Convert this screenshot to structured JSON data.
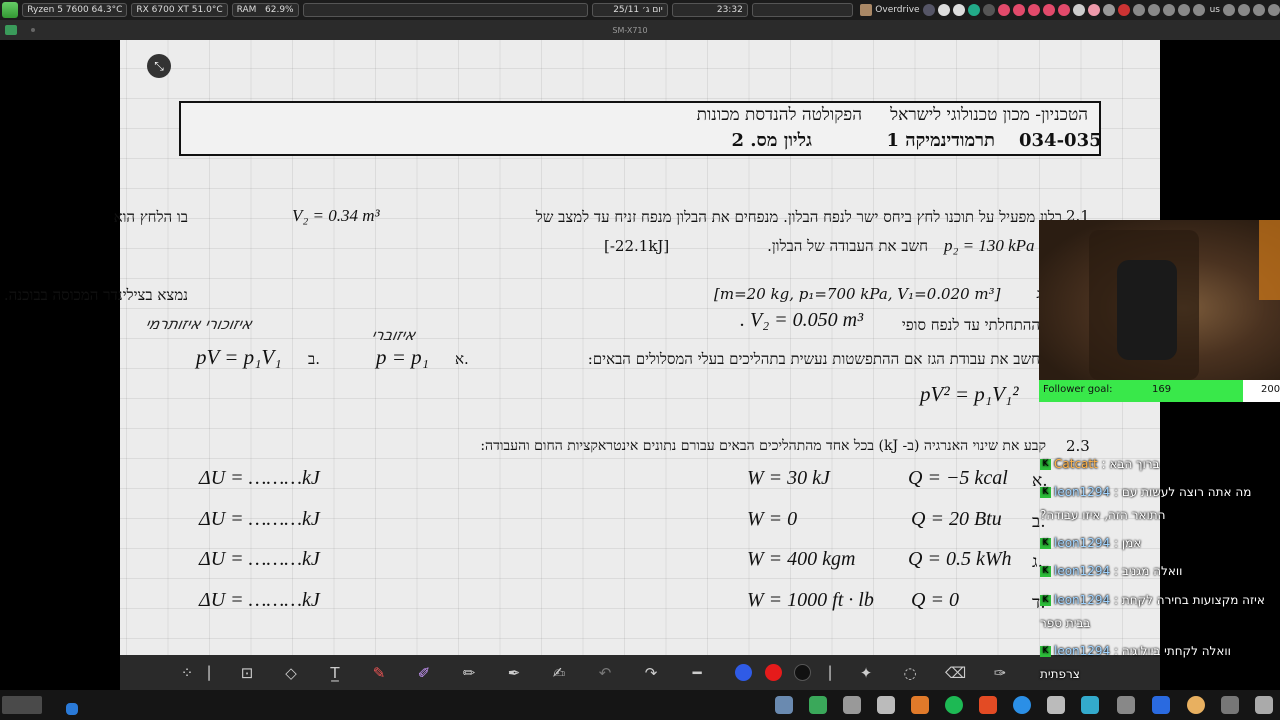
{
  "topbar": {
    "cpu": "Ryzen 5 7600  64.3°C",
    "gpu": "RX 6700 XT 51.0°C",
    "ram_label": "RAM",
    "ram_value": "62.9%",
    "date": "25/11 יום ג׳",
    "time": "23:32",
    "overdrive": "Overdrive",
    "lang": "us"
  },
  "window": {
    "title": "SM-X710"
  },
  "document": {
    "header": {
      "institute": "הטכניון- מכון טכנולוגי לישראל",
      "faculty": "הפקולטה להנדסת מכונות",
      "course_code": "034-035",
      "course_name": "תרמודינמיקה 1",
      "sheet": "גליון מס. 2"
    },
    "q21": {
      "num": "2.1",
      "line1": "בלון מפעיל על תוכנו לחץ ביחס ישר לנפח הבלון. מנפחים את הבלון מנפח זניח עד למצב של",
      "v2": "V₂ = 0.34 m³",
      "line1_end": "בו הלחץ הוא",
      "p2": "p₂ = 130 kPa",
      "line2": "חשב את העבודה של הבלון.",
      "answer": "[-22.1kJ]"
    },
    "q22": {
      "given": "[m=20 kg, p₁=700 kPa, V₁=0.020 m³]",
      "line1": "נמצא בצילינדר המכוסה בבוכנה. הגז מתפשט, בתהליך קוואזיסטטי  מהמצב",
      "prefix": "ג",
      "line2": "ההתחלתי עד לנפח סופי",
      "v2": ". V₂ = 0.050 m³",
      "line3": "חשב את עבודת הגז אם ההתפשטות  נעשית בתהליכים בעלי המסלולים הבאים:",
      "opt_a_label": "א.",
      "opt_a": "p = p₁",
      "opt_b_label": "ב.",
      "opt_b": "pV = p₁V₁",
      "opt_c": "pV² = p₁V₁²",
      "hand_a": "איזוברי",
      "hand_b": "איזוכורי איזותרמי"
    },
    "q23": {
      "num": "2.3",
      "text": "קבע את שינוי האנרגיה (ב- kJ)  בכל אחד מהתהליכים הבאים עבורם נתונים אינטראקציות החום והעבודה:",
      "rows": [
        {
          "label": "א.",
          "q": "Q = −5 kcal",
          "w": "W = 30 kJ",
          "du": "ΔU = ………kJ"
        },
        {
          "label": "ב.",
          "q": "Q = 20 Btu",
          "w": "W = 0",
          "du": "ΔU = ………kJ"
        },
        {
          "label": "ג.",
          "q": "Q = 0.5 kWh",
          "w": "W = 400 kgm",
          "du": "ΔU = ………kJ"
        },
        {
          "label": "ד.",
          "q": "Q = 0",
          "w": "W = 1000 ft · lb",
          "du": "ΔU = ………kJ"
        }
      ]
    }
  },
  "overlay": {
    "goal_label": "Follower goal:",
    "goal_current": "169",
    "goal_target": "200",
    "goal_fraction": 0.845,
    "chat": [
      {
        "user": "Catcatt",
        "msg": "ברוך הבא"
      },
      {
        "user": "leon1294",
        "msg": "מה אתה רוצה לעשות עם"
      },
      {
        "user": "",
        "msg": "?התואר הזה, איזו עבודה"
      },
      {
        "user": "leon1294",
        "msg": "אמן"
      },
      {
        "user": "leon1294",
        "msg": "וואלה מגניב"
      },
      {
        "user": "leon1294",
        "msg": "איזה מקצועות בחירה לקחת"
      },
      {
        "user": "",
        "msg": "בבית ספר"
      },
      {
        "user": "leon1294",
        "msg": "וואלה לקחתי ביולוגיה"
      }
    ],
    "extra": "צרפתית"
  }
}
